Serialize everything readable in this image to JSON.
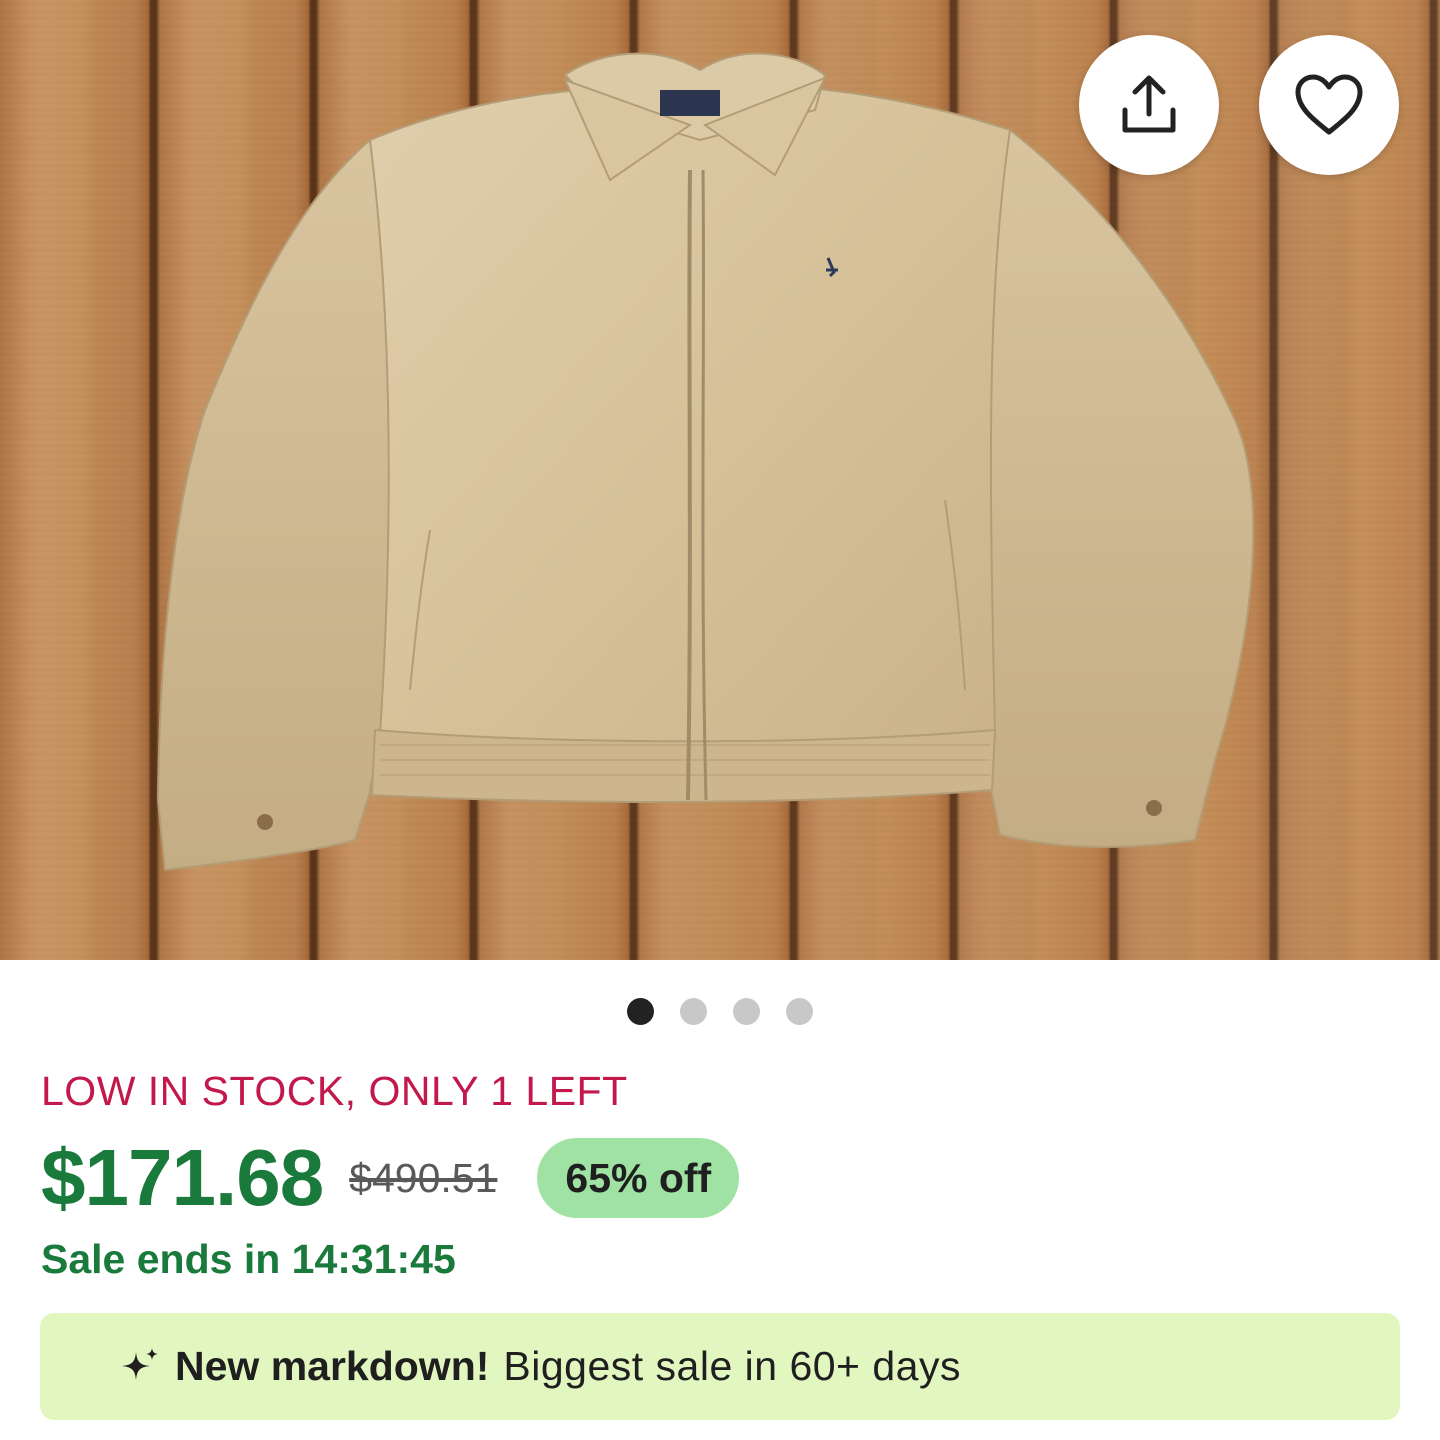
{
  "hero": {
    "slide_count": 4,
    "active_slide": 1
  },
  "product": {
    "stock_notice": "LOW IN STOCK, ONLY 1 LEFT",
    "price": "$171.68",
    "original_price": "$490.51",
    "discount_badge": "65% off",
    "sale_ends": "Sale ends in 14:31:45"
  },
  "banner": {
    "icon": "sparkle-icon",
    "highlight": "New markdown!",
    "text": "Biggest sale in 60+ days"
  },
  "actions": {
    "share_icon": "share-icon",
    "favorite_icon": "heart-icon"
  },
  "colors": {
    "stock_red": "#c2184b",
    "price_green": "#1a7a3c",
    "badge_green": "#9fe2a3",
    "banner_bg": "#e2f7c0"
  }
}
